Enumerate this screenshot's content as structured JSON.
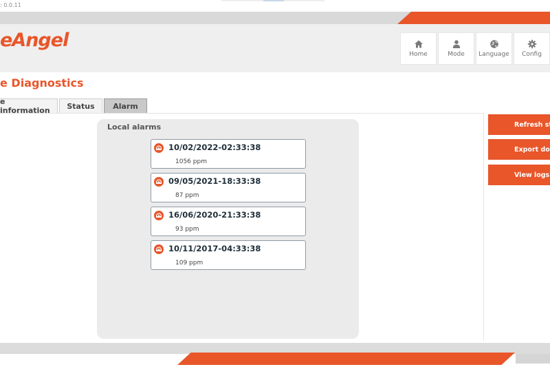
{
  "app": {
    "version_text": ": 0.0.11",
    "logo_text": "eAngel"
  },
  "nav": {
    "items": [
      {
        "label": "Home",
        "icon": "home-icon"
      },
      {
        "label": "Mode",
        "icon": "user-icon"
      },
      {
        "label": "Language",
        "icon": "globe-icon"
      },
      {
        "label": "Config",
        "icon": "gear-icon"
      }
    ]
  },
  "page": {
    "title": "e Diagnostics"
  },
  "tabs": [
    {
      "label": "e information",
      "active": false
    },
    {
      "label": "Status",
      "active": false
    },
    {
      "label": "Alarm",
      "active": true
    }
  ],
  "alarms": {
    "title": "Local alarms",
    "items": [
      {
        "date": "10/02/2022-02:33:38",
        "value": "1056 ppm"
      },
      {
        "date": "09/05/2021-18:33:38",
        "value": "87 ppm"
      },
      {
        "date": "16/06/2020-21:33:38",
        "value": "93 ppm"
      },
      {
        "date": "10/11/2017-04:33:38",
        "value": "109 ppm"
      }
    ]
  },
  "actions": [
    {
      "label": "Refresh stat"
    },
    {
      "label": "Export docx/"
    },
    {
      "label": "View logs"
    }
  ],
  "colors": {
    "accent": "#e8562a",
    "header_bg": "#f0efef",
    "panel_bg": "#ebebeb"
  }
}
